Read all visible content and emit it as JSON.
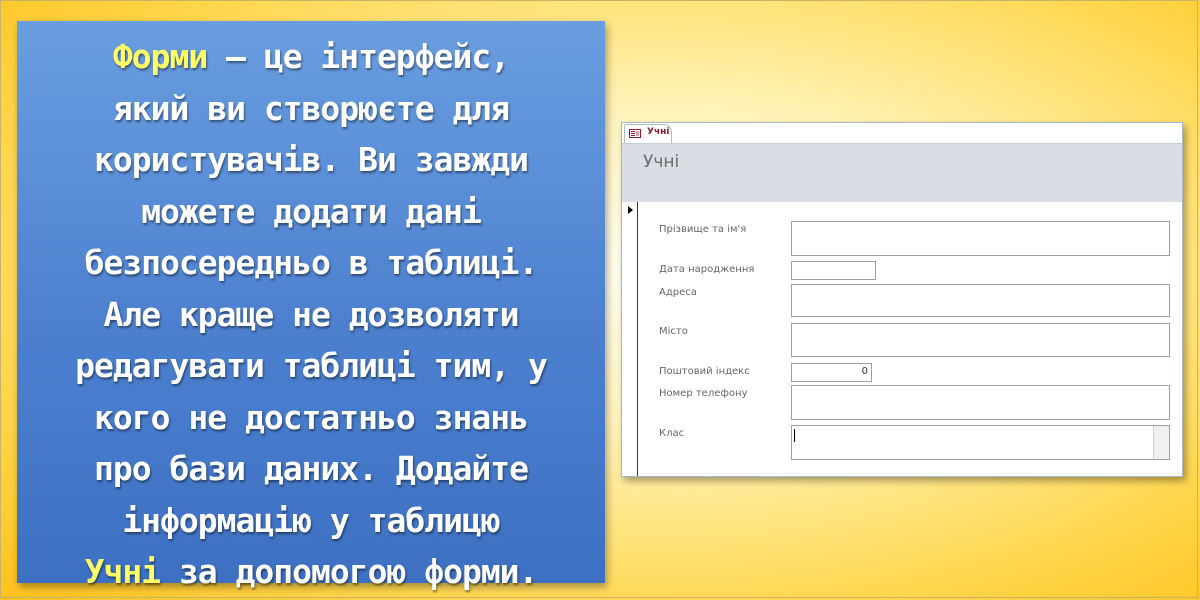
{
  "slide": {
    "lines": [
      {
        "hl": "Форми",
        "text": " – це інтерфейс,"
      },
      {
        "text": "який ви створюєте для"
      },
      {
        "text": "користувачів. Ви завжди"
      },
      {
        "text": "можете додати дані"
      },
      {
        "text": "безпосередньо в таблиці."
      },
      {
        "text": "Але краще не дозволяти"
      },
      {
        "text": "редагувати таблиці тим, у"
      },
      {
        "text": "кого не достатньо знань"
      },
      {
        "text": "про бази даних. Додайте"
      },
      {
        "text": "інформацію у таблицю"
      },
      {
        "hl": "Учні",
        "text": " за допомогою форми."
      }
    ],
    "highlight_color": "#ffff66"
  },
  "form": {
    "tab_label": "Учні",
    "title": "Учні",
    "fields": {
      "name": {
        "label": "Прізвище та ім'я",
        "value": ""
      },
      "birth_date": {
        "label": "Дата народження",
        "value": ""
      },
      "address": {
        "label": "Адреса",
        "value": ""
      },
      "city": {
        "label": "Місто",
        "value": ""
      },
      "postal_code": {
        "label": "Поштовий індекс",
        "value": "0"
      },
      "phone": {
        "label": "Номер телефону",
        "value": ""
      },
      "class": {
        "label": "Клас",
        "value": ""
      }
    }
  }
}
